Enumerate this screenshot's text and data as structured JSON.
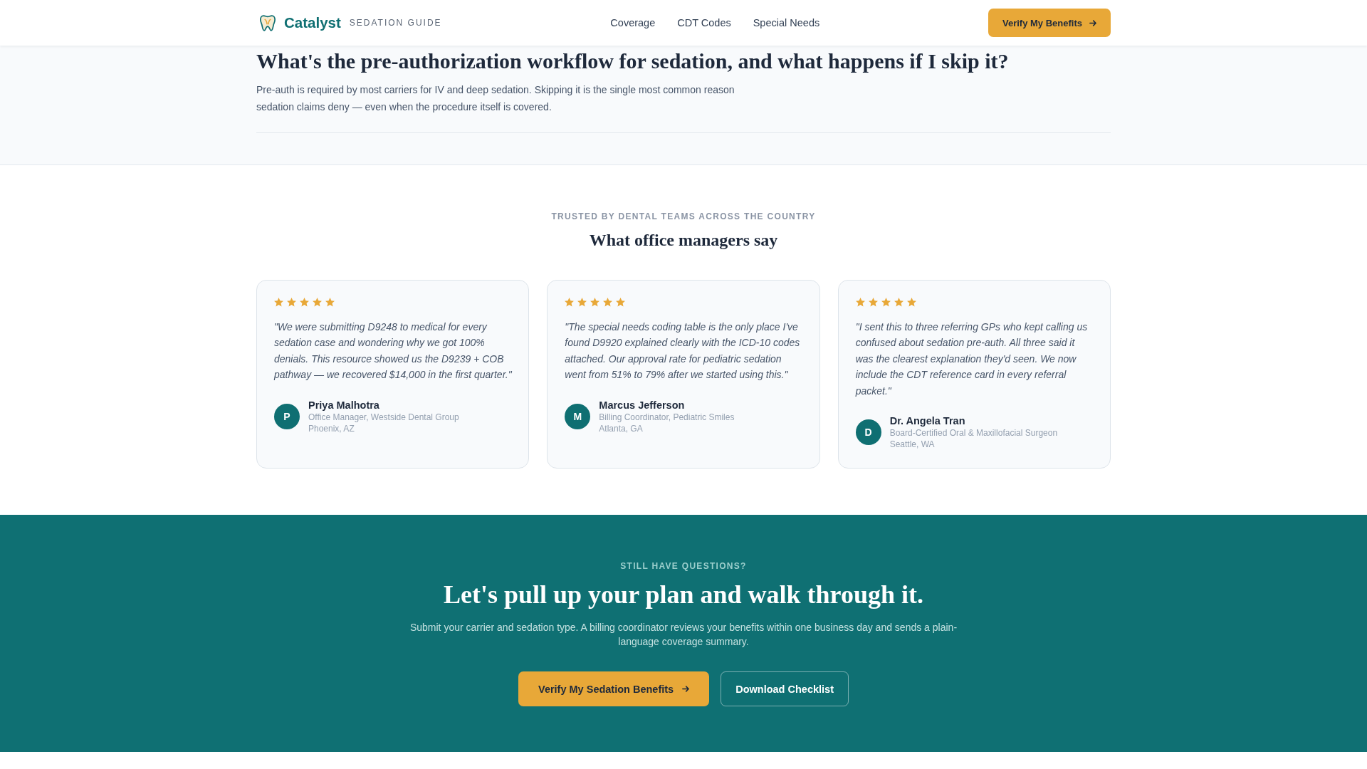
{
  "header": {
    "brand": "Catalyst",
    "tagline": "SEDATION GUIDE",
    "nav": [
      {
        "label": "Coverage"
      },
      {
        "label": "CDT Codes"
      },
      {
        "label": "Special Needs"
      }
    ],
    "cta": "Verify My Benefits"
  },
  "article": {
    "heading": "What's the pre-authorization workflow for sedation, and what happens if I skip it?",
    "body": "Pre-auth is required by most carriers for IV and deep sedation. Skipping it is the single most common reason sedation claims deny — even when the procedure itself is covered."
  },
  "testimonials": {
    "eyebrow": "TRUSTED BY DENTAL TEAMS ACROSS THE COUNTRY",
    "title": "What office managers say",
    "items": [
      {
        "stars": 5,
        "quote": "\"We were submitting D9248 to medical for every sedation case and wondering why we got 100% denials. This resource showed us the D9239 + COB pathway — we recovered $14,000 in the first quarter.\"",
        "initial": "P",
        "name": "Priya Malhotra",
        "role": "Office Manager, Westside Dental Group",
        "location": "Phoenix, AZ"
      },
      {
        "stars": 5,
        "quote": "\"The special needs coding table is the only place I've found D9920 explained clearly with the ICD-10 codes attached. Our approval rate for pediatric sedation went from 51% to 79% after we started using this.\"",
        "initial": "M",
        "name": "Marcus Jefferson",
        "role": "Billing Coordinator, Pediatric Smiles",
        "location": "Atlanta, GA"
      },
      {
        "stars": 5,
        "quote": "\"I sent this to three referring GPs who kept calling us confused about sedation pre-auth. All three said it was the clearest explanation they'd seen. We now include the CDT reference card in every referral packet.\"",
        "initial": "D",
        "name": "Dr. Angela Tran",
        "role": "Board-Certified Oral & Maxillofacial Surgeon",
        "location": "Seattle, WA"
      }
    ]
  },
  "cta": {
    "eyebrow": "STILL HAVE QUESTIONS?",
    "title": "Let's pull up your plan and walk through it.",
    "body": "Submit your carrier and sedation type. A billing coordinator reviews your benefits within one business day and sends a plain-language coverage summary.",
    "buttons": [
      {
        "kind": "primary",
        "label": "Verify My Sedation Benefits"
      },
      {
        "kind": "secondary",
        "label": "Download Checklist"
      }
    ]
  }
}
